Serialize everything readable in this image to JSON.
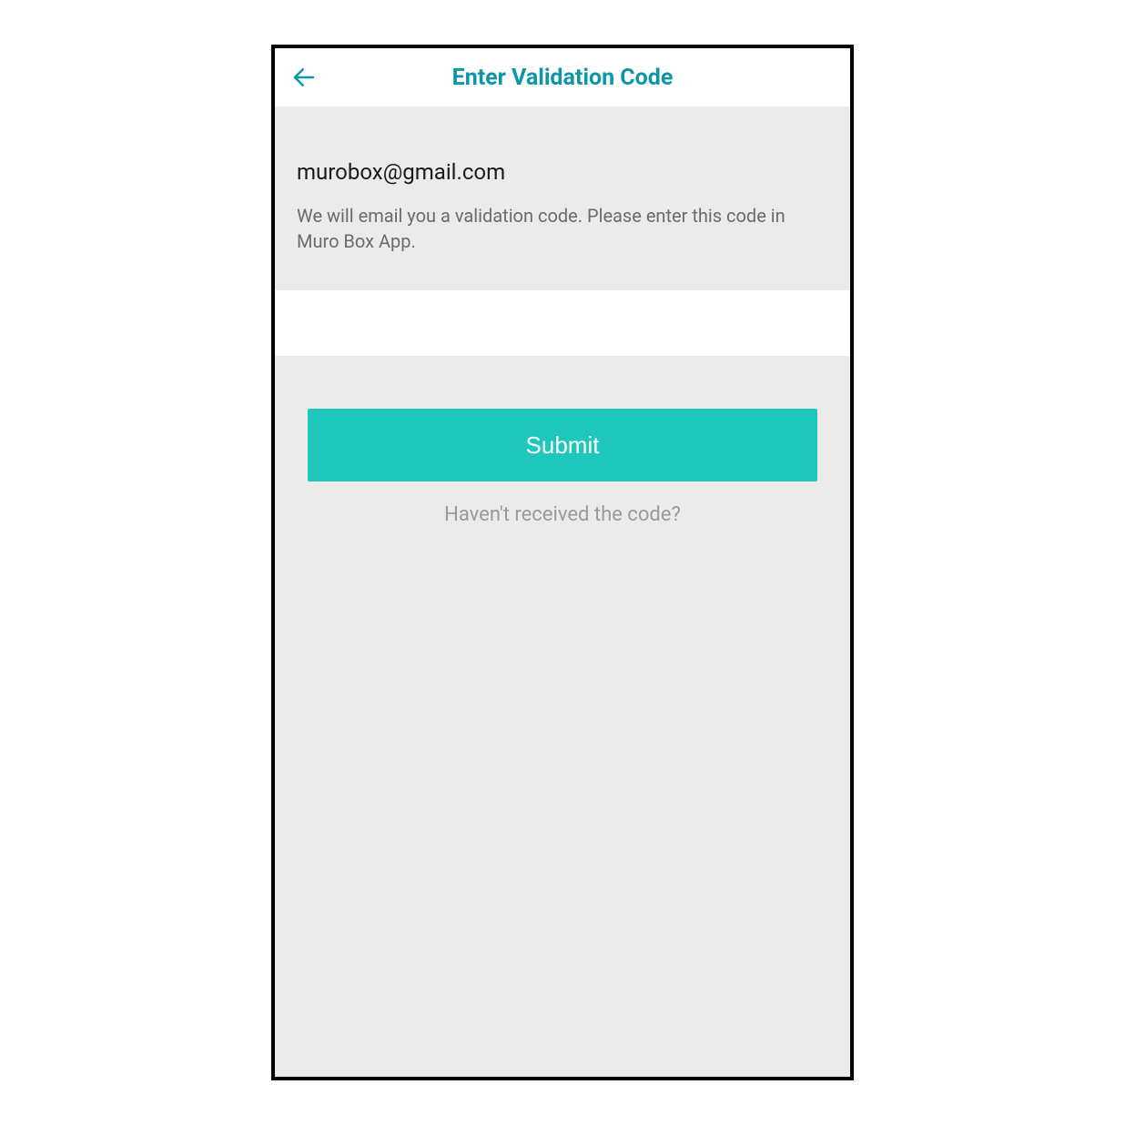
{
  "header": {
    "title": "Enter Validation Code"
  },
  "info": {
    "email": "murobox@gmail.com",
    "instruction": "We will email you a validation code. Please enter this code in Muro Box App."
  },
  "code_input": {
    "value": "",
    "placeholder": ""
  },
  "actions": {
    "submit_label": "Submit",
    "resend_label": "Haven't received the code?"
  },
  "colors": {
    "accent": "#0d96a6",
    "button": "#1ec6bc",
    "background": "#ebebeb"
  }
}
